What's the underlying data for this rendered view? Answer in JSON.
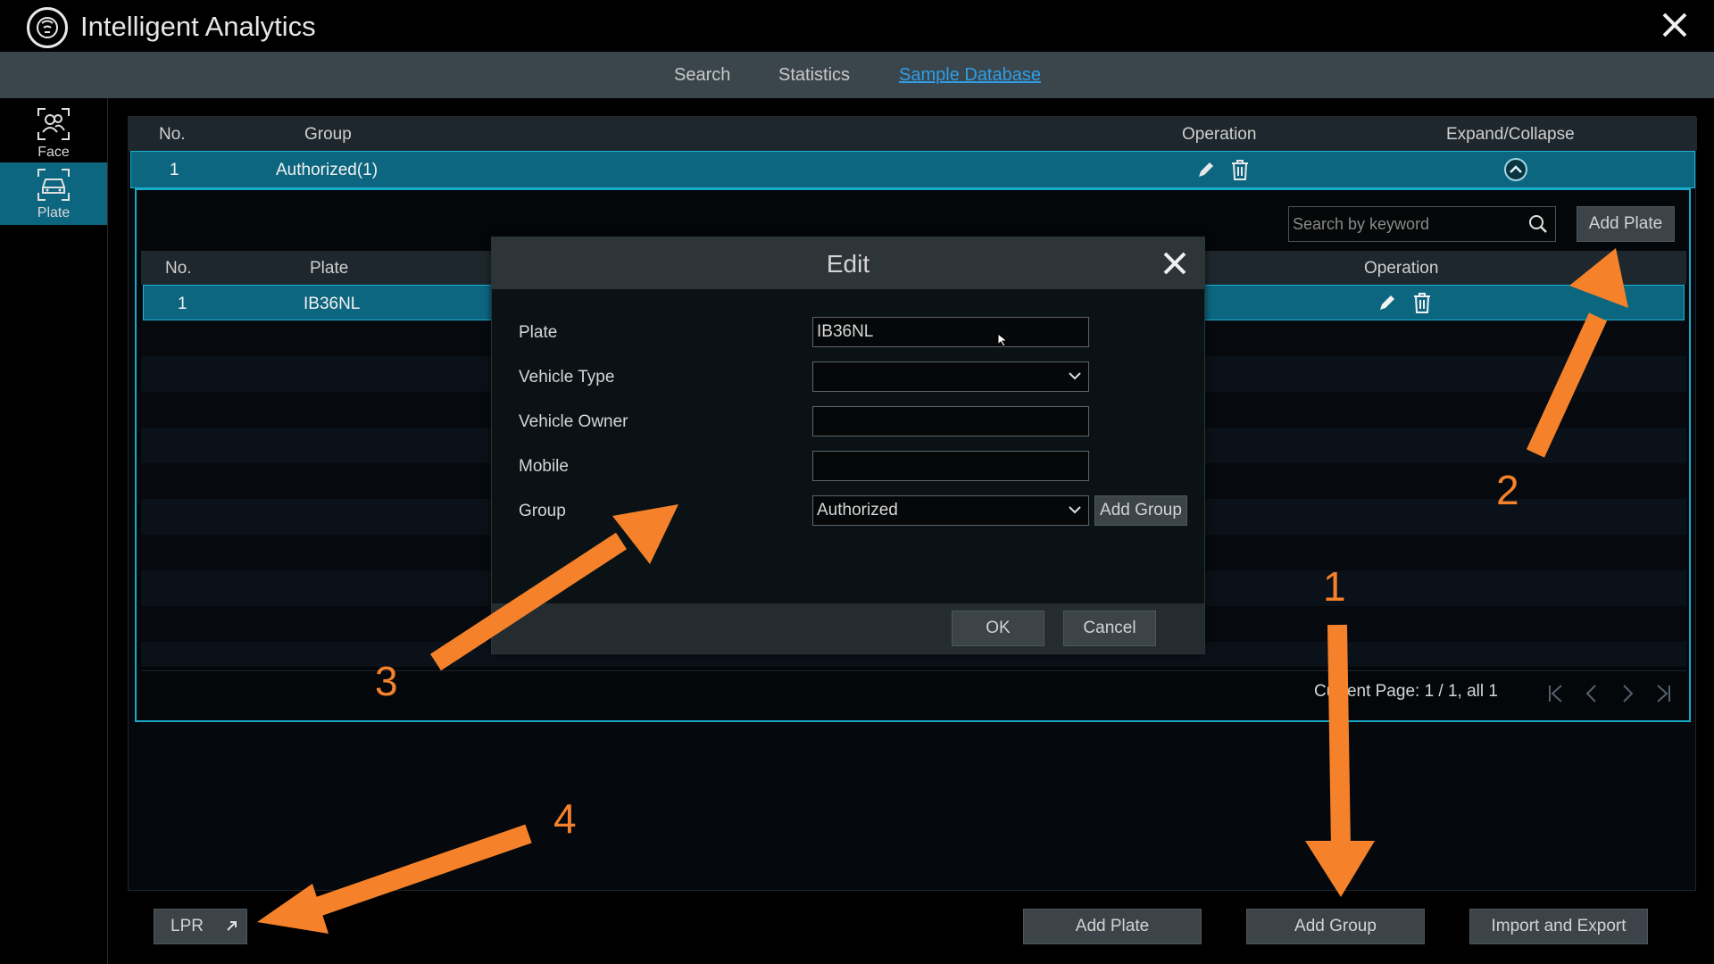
{
  "app": {
    "title": "Intelligent Analytics"
  },
  "tabs": [
    {
      "label": "Search"
    },
    {
      "label": "Statistics"
    },
    {
      "label": "Sample Database"
    }
  ],
  "sidebar": {
    "items": [
      {
        "label": "Face",
        "icon": "face-icon"
      },
      {
        "label": "Plate",
        "icon": "plate-icon"
      }
    ]
  },
  "group_table": {
    "headers": {
      "no": "No.",
      "group": "Group",
      "operation": "Operation",
      "expand": "Expand/Collapse"
    },
    "rows": [
      {
        "no": "1",
        "group": "Authorized(1)"
      }
    ]
  },
  "plate_panel": {
    "search_placeholder": "Search by keyword",
    "add_plate_label": "Add Plate",
    "headers": {
      "no": "No.",
      "plate": "Plate",
      "operation": "Operation"
    },
    "rows": [
      {
        "no": "1",
        "plate": "IB36NL"
      }
    ],
    "pager_text": "Current Page: 1 / 1, all 1"
  },
  "bottom_bar": {
    "lpr_label": "LPR",
    "add_plate_label": "Add Plate",
    "add_group_label": "Add Group",
    "import_export_label": "Import and Export"
  },
  "edit_dialog": {
    "title": "Edit",
    "fields": {
      "plate": {
        "label": "Plate",
        "value": "IB36NL"
      },
      "vehicle_type": {
        "label": "Vehicle Type",
        "value": ""
      },
      "vehicle_owner": {
        "label": "Vehicle Owner",
        "value": ""
      },
      "mobile": {
        "label": "Mobile",
        "value": ""
      },
      "group": {
        "label": "Group",
        "value": "Authorized"
      }
    },
    "add_group_label": "Add Group",
    "ok_label": "OK",
    "cancel_label": "Cancel"
  },
  "annotations": [
    {
      "number": "1"
    },
    {
      "number": "2"
    },
    {
      "number": "3"
    },
    {
      "number": "4"
    }
  ],
  "colors": {
    "accent": "#0d6680",
    "link": "#2f9ee6",
    "annotation": "#f5822a"
  }
}
